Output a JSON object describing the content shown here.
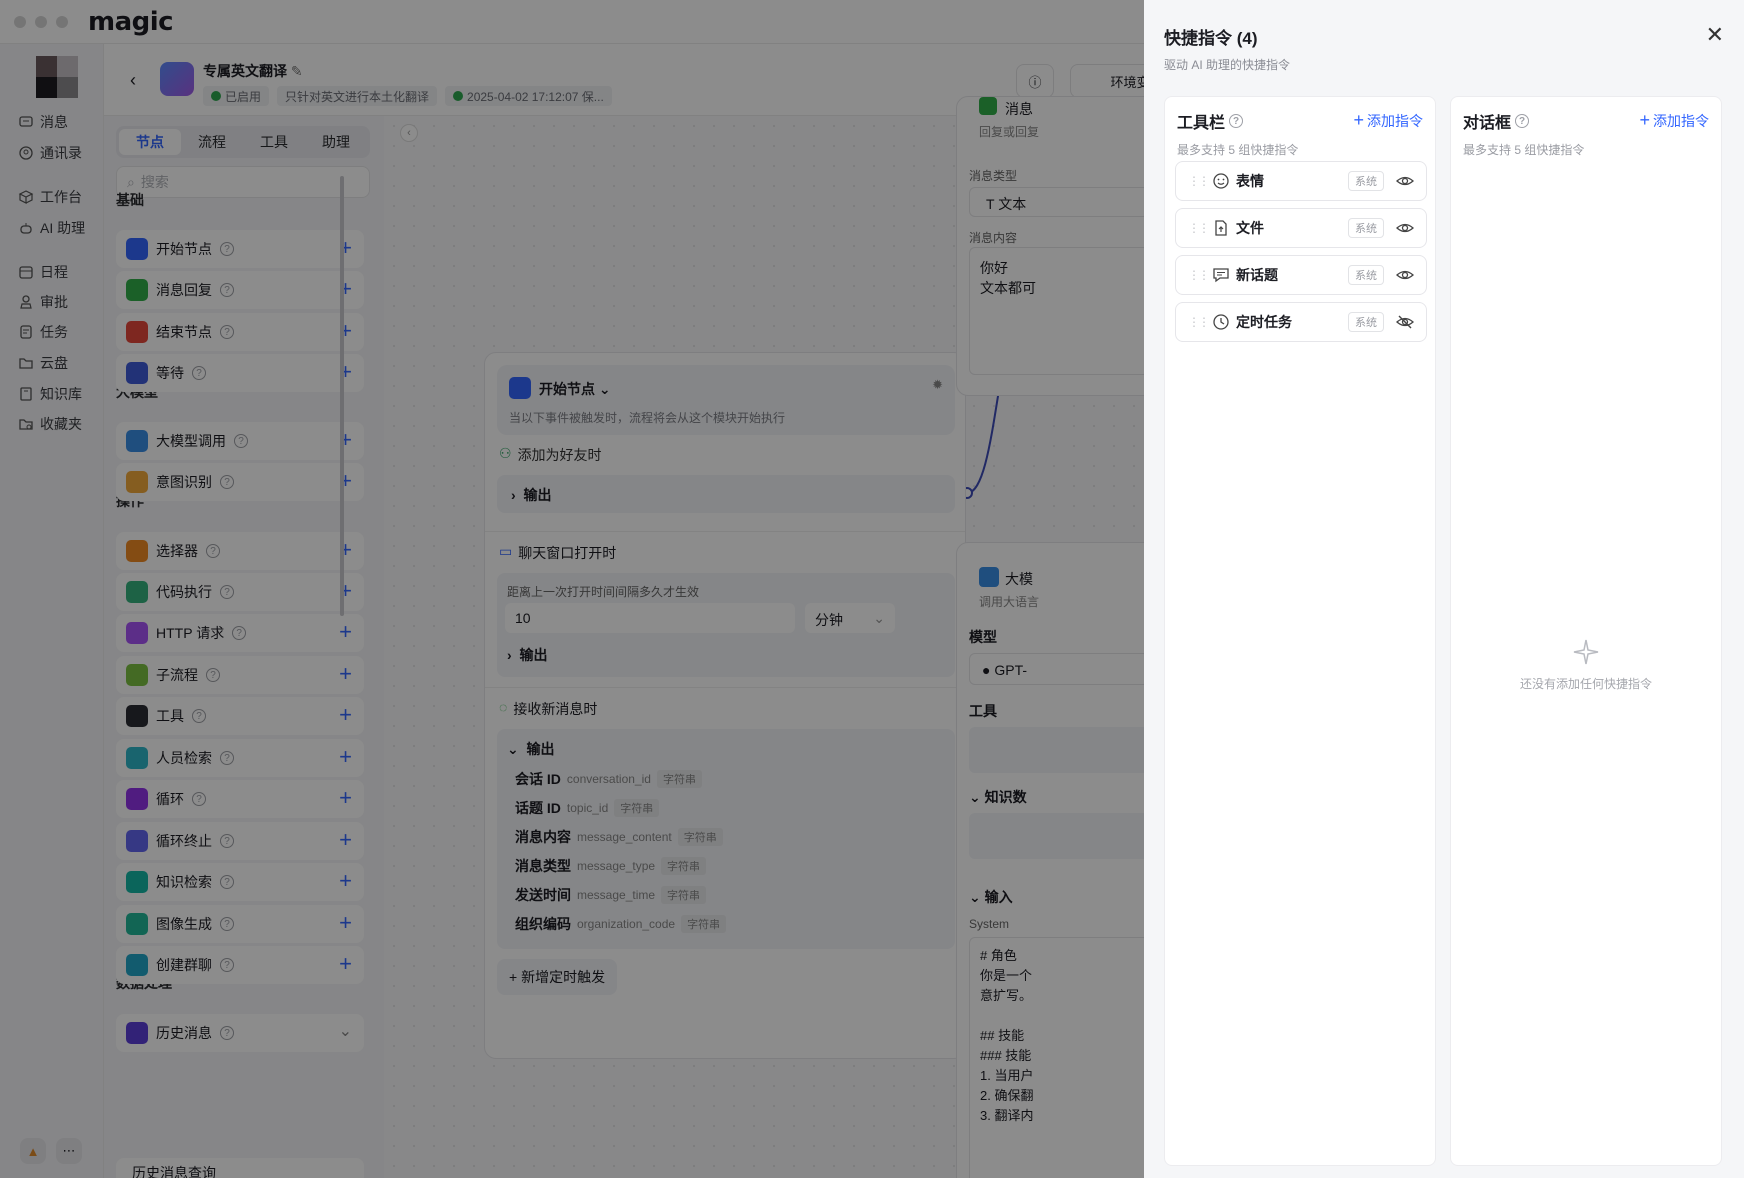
{
  "app": {
    "logo": "magic"
  },
  "sidebar": {
    "items": [
      {
        "label": "消息",
        "icon": "message-icon"
      },
      {
        "label": "通讯录",
        "icon": "contacts-icon"
      },
      {
        "label": "工作台",
        "icon": "workbench-icon"
      },
      {
        "label": "AI 助理",
        "icon": "robot-icon"
      },
      {
        "label": "日程",
        "icon": "calendar-icon"
      },
      {
        "label": "审批",
        "icon": "approval-icon"
      },
      {
        "label": "任务",
        "icon": "task-icon"
      },
      {
        "label": "云盘",
        "icon": "folder-icon"
      },
      {
        "label": "知识库",
        "icon": "book-icon"
      },
      {
        "label": "收藏夹",
        "icon": "bookmark-icon"
      }
    ]
  },
  "header": {
    "title": "专属英文翻译",
    "status": "已启用",
    "description": "只针对英文进行本土化翻译",
    "saved": "2025-04-02 17:12:07 保...",
    "env_button": "环境变"
  },
  "panel": {
    "tabs": [
      "节点",
      "流程",
      "工具",
      "助理"
    ],
    "search_placeholder": "搜索",
    "sections": {
      "basic": "基础",
      "llm": "大模型",
      "ops": "操作",
      "data": "数据处理"
    },
    "nodes": [
      {
        "label": "开始节点",
        "color": "#3366ff"
      },
      {
        "label": "消息回复",
        "color": "#32b04a"
      },
      {
        "label": "结束节点",
        "color": "#e5483b"
      },
      {
        "label": "等待",
        "color": "#3f5bd9"
      },
      {
        "label": "大模型调用",
        "color": "#3a8ee6"
      },
      {
        "label": "意图识别",
        "color": "#f2a93b"
      },
      {
        "label": "选择器",
        "color": "#f08a24"
      },
      {
        "label": "代码执行",
        "color": "#35b37e"
      },
      {
        "label": "HTTP 请求",
        "color": "#a855f7"
      },
      {
        "label": "子流程",
        "color": "#7cc242"
      },
      {
        "label": "工具",
        "color": "#2b2d33"
      },
      {
        "label": "人员检索",
        "color": "#2fb6c9"
      },
      {
        "label": "循环",
        "color": "#9333ea"
      },
      {
        "label": "循环终止",
        "color": "#6366f1"
      },
      {
        "label": "知识检索",
        "color": "#14b8a6"
      },
      {
        "label": "图像生成",
        "color": "#22b89a"
      },
      {
        "label": "创建群聊",
        "color": "#22a7c9"
      },
      {
        "label": "历史消息",
        "color": "#5b3fd9"
      }
    ],
    "last_partial": "历史消息查询"
  },
  "canvas": {
    "start_node": {
      "title": "开始节点",
      "subtitle": "当以下事件被触发时，流程将会从这个模块开始执行",
      "trigger1": "添加为好友时",
      "output": "输出",
      "trigger2": "聊天窗口打开时",
      "interval_label": "距离上一次打开时间间隔多久才生效",
      "interval_value": "10",
      "interval_unit": "分钟",
      "trigger3": "接收新消息时",
      "fields": [
        {
          "name": "会话 ID",
          "key": "conversation_id",
          "type": "字符串"
        },
        {
          "name": "话题 ID",
          "key": "topic_id",
          "type": "字符串"
        },
        {
          "name": "消息内容",
          "key": "message_content",
          "type": "字符串"
        },
        {
          "name": "消息类型",
          "key": "message_type",
          "type": "字符串"
        },
        {
          "name": "发送时间",
          "key": "message_time",
          "type": "字符串"
        },
        {
          "name": "组织编码",
          "key": "organization_code",
          "type": "字符串"
        }
      ],
      "add_trigger": "+ 新增定时触发"
    },
    "msg_node": {
      "title": "消息",
      "sub": "回复或回复",
      "type_label": "消息类型",
      "type_value": "文本",
      "content_label": "消息内容",
      "content_text1": "你好",
      "content_text2": "文本都可"
    },
    "llm_node": {
      "title": "大模",
      "sub": "调用大语言",
      "model_label": "模型",
      "model_value": "GPT-",
      "tools_label": "工具",
      "kb_label": "知识数",
      "input_label": "输入",
      "system_label": "System",
      "prompt_lines": [
        "# 角色",
        "你是一个",
        "意扩写。",
        "",
        "## 技能",
        "### 技能",
        "1. 当用户",
        "2. 确保翻",
        "3. 翻译内"
      ]
    }
  },
  "drawer": {
    "title": "快捷指令 (4)",
    "subtitle": "驱动 AI 助理的快捷指令",
    "toolbar": {
      "title": "工具栏",
      "add": "添加指令",
      "note": "最多支持 5 组快捷指令",
      "commands": [
        {
          "label": "表情",
          "tag": "系统",
          "icon": "emoji-icon",
          "visible": true
        },
        {
          "label": "文件",
          "tag": "系统",
          "icon": "file-upload-icon",
          "visible": true
        },
        {
          "label": "新话题",
          "tag": "系统",
          "icon": "new-topic-icon",
          "visible": true
        },
        {
          "label": "定时任务",
          "tag": "系统",
          "icon": "clock-icon",
          "visible": false
        }
      ]
    },
    "dialog": {
      "title": "对话框",
      "add": "添加指令",
      "note": "最多支持 5 组快捷指令",
      "empty": "还没有添加任何快捷指令"
    }
  }
}
